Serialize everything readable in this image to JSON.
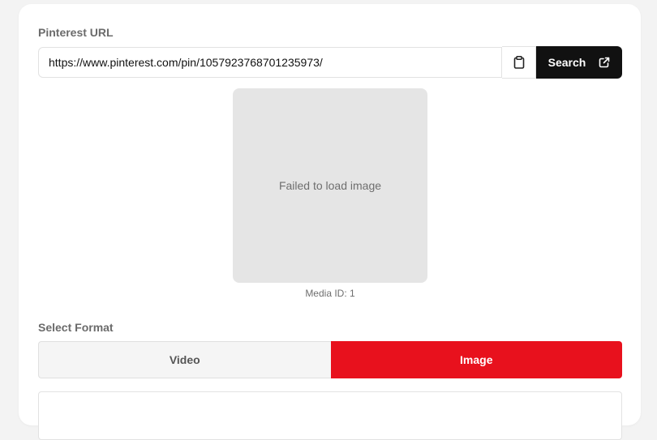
{
  "form": {
    "url_label": "Pinterest URL",
    "url_value": "https://www.pinterest.com/pin/1057923768701235973/",
    "search_label": "Search"
  },
  "preview": {
    "message": "Failed to load image",
    "media_id": "Media ID: 1"
  },
  "format": {
    "label": "Select Format",
    "options": [
      "Video",
      "Image"
    ],
    "selected": "Image"
  },
  "colors": {
    "accent": "#e8111d",
    "button_dark": "#111111"
  },
  "icons": {
    "paste": "clipboard-icon",
    "search": "external-link-icon"
  }
}
